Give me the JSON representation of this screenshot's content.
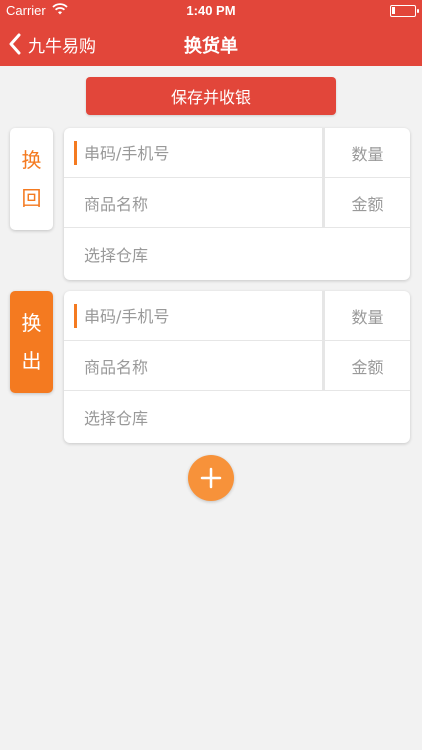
{
  "status_bar": {
    "carrier": "Carrier",
    "time": "1:40 PM"
  },
  "nav": {
    "back_label": "九牛易购",
    "title": "换货单"
  },
  "actions": {
    "save_label": "保存并收银"
  },
  "sections": [
    {
      "tab_chars": [
        "换",
        "回"
      ],
      "code_placeholder": "串码/手机号",
      "qty_placeholder": "数量",
      "product_placeholder": "商品名称",
      "amount_placeholder": "金额",
      "warehouse_placeholder": "选择仓库"
    },
    {
      "tab_chars": [
        "换",
        "出"
      ],
      "code_placeholder": "串码/手机号",
      "qty_placeholder": "数量",
      "product_placeholder": "商品名称",
      "amount_placeholder": "金额",
      "warehouse_placeholder": "选择仓库"
    }
  ],
  "colors": {
    "brand_red": "#e2463a",
    "accent_orange": "#f47a20",
    "add_button": "#f7923a"
  },
  "icons": {
    "back": "chevron-left-icon",
    "add": "plus-icon",
    "wifi": "wifi-icon",
    "battery": "battery-icon"
  }
}
